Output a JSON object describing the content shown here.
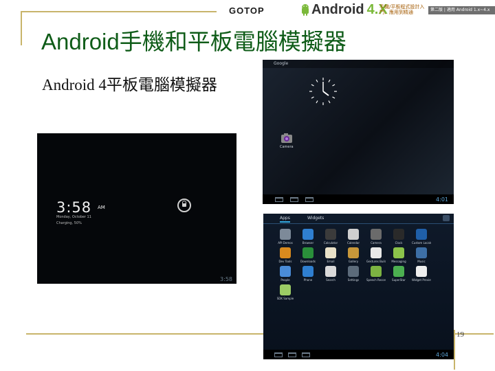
{
  "header": {
    "publisher": "GOTOP",
    "book_title": "Android",
    "book_version": "4.X",
    "book_subtitle": "手機/平板程式設計入門、應用到精通",
    "book_tag": "第二版 | 適用 Android 1.x~4.x"
  },
  "slide": {
    "title": "Android手機和平板電腦模擬器",
    "subtitle": "Android 4平板電腦模擬器",
    "page_number": "19"
  },
  "home_screen": {
    "search_label": "Google",
    "camera_label": "Camera",
    "status_time": "4:01"
  },
  "lock_screen": {
    "time": "3:58",
    "ampm": "AM",
    "date": "Monday, October 11",
    "charging": "Charging, 50%",
    "status_time": "3:58"
  },
  "apps_screen": {
    "tabs": [
      "Apps",
      "Widgets"
    ],
    "status_time": "4:04",
    "apps": [
      {
        "label": "API Demos",
        "color": "#7d8a99"
      },
      {
        "label": "Browser",
        "color": "#2f7fd0"
      },
      {
        "label": "Calculator",
        "color": "#3b3b3b"
      },
      {
        "label": "Calendar",
        "color": "#cfcfcf"
      },
      {
        "label": "Camera",
        "color": "#6b6b6b"
      },
      {
        "label": "Clock",
        "color": "#2a2a2a"
      },
      {
        "label": "Custom Locale",
        "color": "#1f5fa8"
      },
      {
        "label": "Dev Tools",
        "color": "#d98a1e"
      },
      {
        "label": "Downloads",
        "color": "#2a8f3a"
      },
      {
        "label": "Email",
        "color": "#e9e1c8"
      },
      {
        "label": "Gallery",
        "color": "#c7973a"
      },
      {
        "label": "Gestures Builder",
        "color": "#e8e8e8"
      },
      {
        "label": "Messaging",
        "color": "#8bc34a"
      },
      {
        "label": "Music",
        "color": "#3d6fa6"
      },
      {
        "label": "People",
        "color": "#4a8cd8"
      },
      {
        "label": "Phone",
        "color": "#2f7fd0"
      },
      {
        "label": "Search",
        "color": "#d9d9d9"
      },
      {
        "label": "Settings",
        "color": "#5c6b7a"
      },
      {
        "label": "Speech Recorder",
        "color": "#7cb342"
      },
      {
        "label": "SuperStar",
        "color": "#4caf50"
      },
      {
        "label": "Widget Preview",
        "color": "#eeeeee"
      },
      {
        "label": "SDK Sample",
        "color": "#9ccc65"
      }
    ]
  }
}
